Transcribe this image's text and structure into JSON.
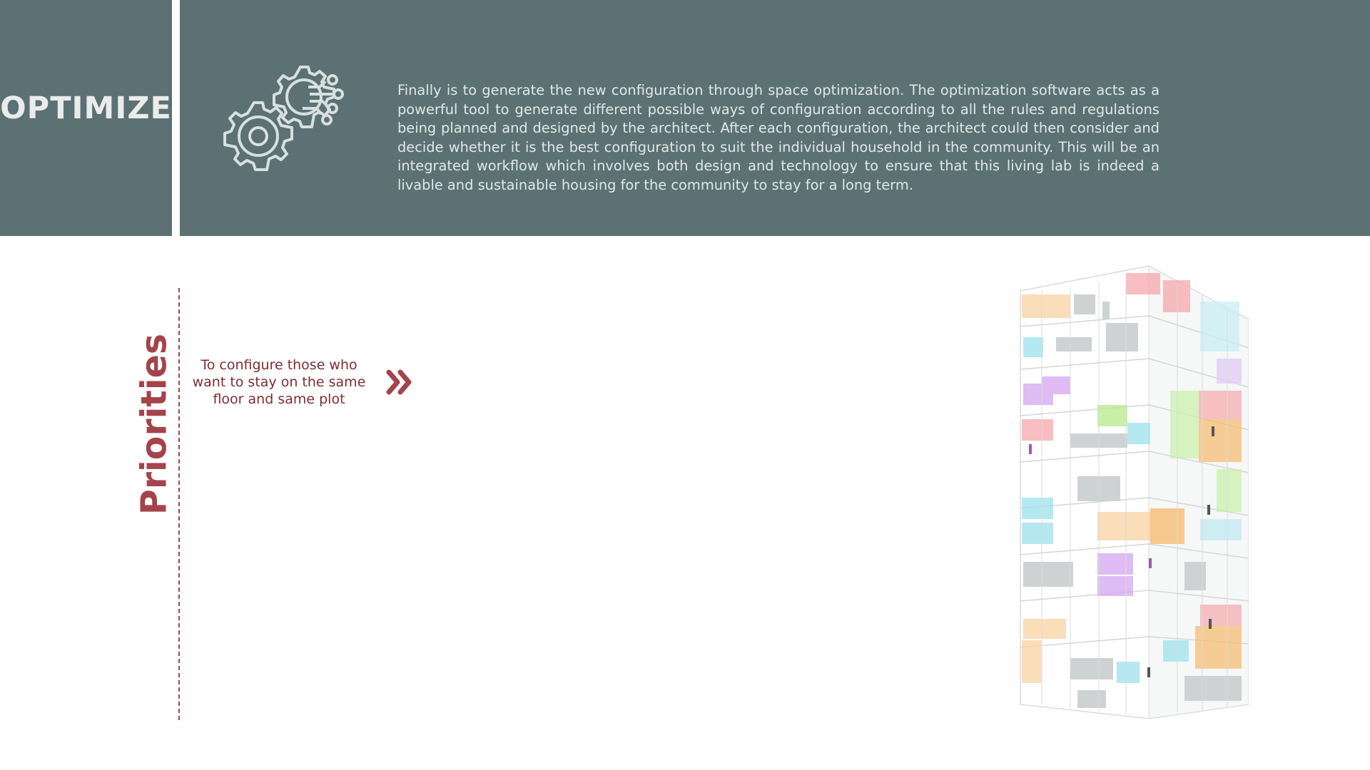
{
  "header": {
    "title": "OPTIMIZE",
    "icon": "gears-icon",
    "description": "Finally is to generate the new configuration through space optimization. The optimization software acts as a powerful tool to generate different possible ways of configuration according to all the rules and regulations being planned and designed by the architect. After each configuration, the architect could then consider and decide whether it is the best configuration to suit the individual household in the community. This will be an integrated workflow which involves both design and technology to ensure that this living lab is indeed a livable and sustainable housing for the community to stay for a long term."
  },
  "priorities": {
    "label": "Priorities",
    "item_text": "To configure those who want to stay on the same floor and same plot",
    "arrow_icon": "double-chevron-right-icon"
  },
  "illustration": {
    "name": "building-axonometric-illustration"
  },
  "colors": {
    "band": "#5b7173",
    "accent": "#a5434c",
    "text_dark": "#7f2c32"
  }
}
